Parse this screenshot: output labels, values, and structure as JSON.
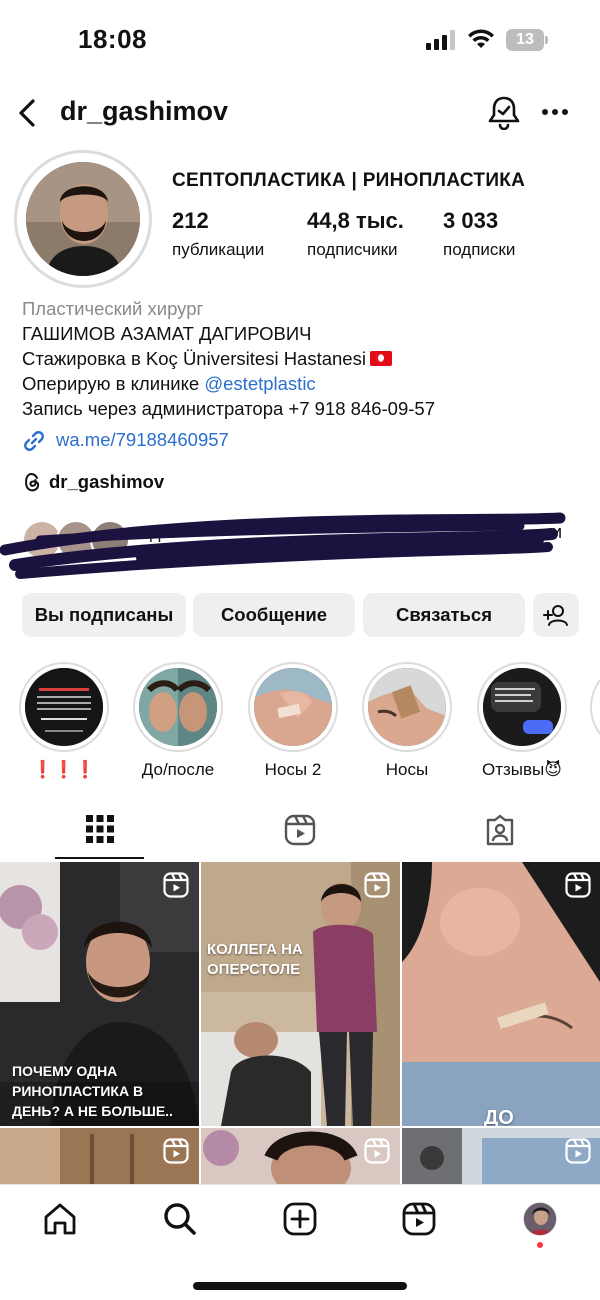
{
  "status_bar": {
    "time": "18:08",
    "battery": "13"
  },
  "header": {
    "username": "dr_gashimov",
    "icons": [
      "back-icon",
      "notification-bell-icon",
      "more-icon"
    ]
  },
  "profile": {
    "display_name": "СЕПТОПЛАСТИКА | РИНОПЛАСТИКА",
    "stats": [
      {
        "value": "212",
        "label": "публикации"
      },
      {
        "value": "44,8 тыс.",
        "label": "подписчики"
      },
      {
        "value": "3 033",
        "label": "подписки"
      }
    ],
    "bio": {
      "category": "Пластический хирург",
      "line1": "ГАШИМОВ АЗАМАТ ДАГИРОВИЧ",
      "line2": "Стажировка в Koç Üniversitesi Hastanesi",
      "line3_prefix": "Оперирую в клинике ",
      "line3_mention": "@estetplastic",
      "line4": "Запись через администратора +7 918 846-09-57"
    },
    "link": "wa.me/79188460957",
    "threads": "dr_gashimov"
  },
  "followed_by": {
    "text_visible": "д...",
    "tail": "и"
  },
  "actions": {
    "following": "Вы подписаны",
    "message": "Сообщение",
    "contact": "Связаться"
  },
  "highlights": [
    {
      "label": "❗❗❗"
    },
    {
      "label": "До/после"
    },
    {
      "label": "Носы 2"
    },
    {
      "label": "Носы"
    },
    {
      "label": "Отзывы😈"
    }
  ],
  "grid": {
    "posts": [
      {
        "caption": "ПОЧЕМУ ОДНА РИНОПЛАСТИКА В ДЕНЬ? А НЕ БОЛЬШЕ..",
        "type": "reel"
      },
      {
        "caption": "КОЛЛЕГА НА ОПЕРСТОЛЕ",
        "type": "reel"
      },
      {
        "caption": "ДО",
        "type": "reel"
      },
      {
        "caption": "",
        "type": "reel"
      },
      {
        "caption": "",
        "type": "reel"
      },
      {
        "caption": "",
        "type": "reel"
      }
    ]
  },
  "colors": {
    "link": "#2b6fcf",
    "button_bg": "#efefef",
    "notification_dot": "#ff3040"
  }
}
